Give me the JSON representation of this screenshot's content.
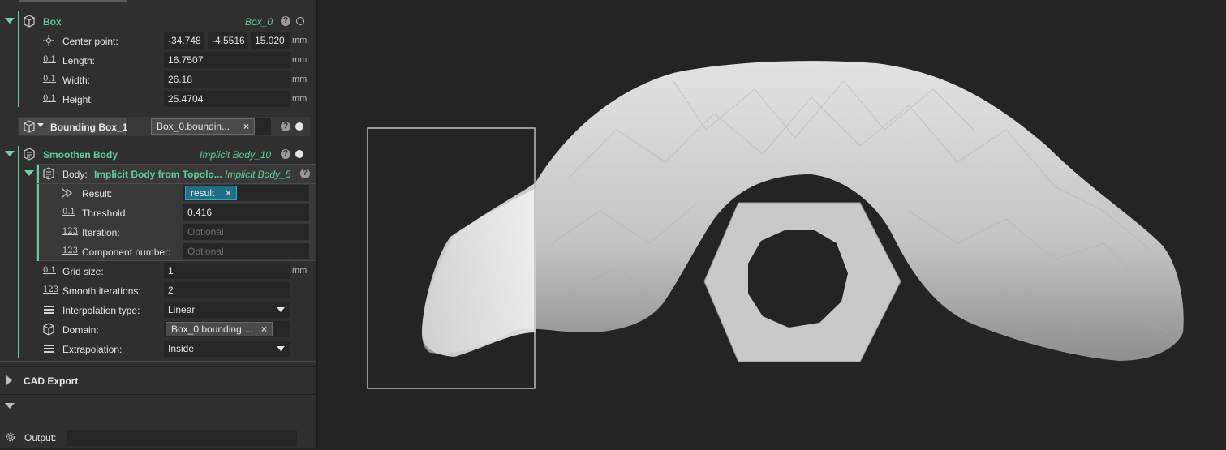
{
  "box": {
    "title": "Box",
    "ref": "Box_0",
    "center_label": "Center point:",
    "center": [
      "-34.748",
      "-4.5516",
      "15.020"
    ],
    "length_label": "Length:",
    "length": "16.7507",
    "width_label": "Width:",
    "width": "26.18",
    "height_label": "Height:",
    "height": "25.4704",
    "unit": "mm"
  },
  "bounding": {
    "title": "Bounding Box_1",
    "value": "Box_0.boundin..."
  },
  "smoothen": {
    "title": "Smoothen Body",
    "ref": "Implicit Body_10",
    "body_label": "Body:",
    "body_value": "Implicit Body from Topolo...",
    "body_ref": "Implicit Body_5",
    "result_label": "Result:",
    "result_value": "result",
    "threshold_label": "Threshold:",
    "threshold": "0.416",
    "iteration_label": "Iteration:",
    "iteration_placeholder": "Optional",
    "component_label": "Component number:",
    "component_placeholder": "Optional",
    "grid_label": "Grid size:",
    "grid": "1",
    "smooth_label": "Smooth iterations:",
    "smooth": "2",
    "interp_label": "Interpolation type:",
    "interp": "Linear",
    "domain_label": "Domain:",
    "domain": "Box_0.bounding ...",
    "extrap_label": "Extrapolation:",
    "extrap": "Inside",
    "unit": "mm"
  },
  "sections": {
    "cad_export": "CAD Export"
  },
  "output": {
    "label": "Output:",
    "value": ""
  },
  "icons": {
    "help": "?",
    "num": "0.1",
    "int": "123",
    "close": "×"
  },
  "colors": {
    "accent": "#5fcf9a",
    "panel": "#2f2f2f",
    "viewport": "#242424",
    "mesh": "#c8c8c8"
  }
}
